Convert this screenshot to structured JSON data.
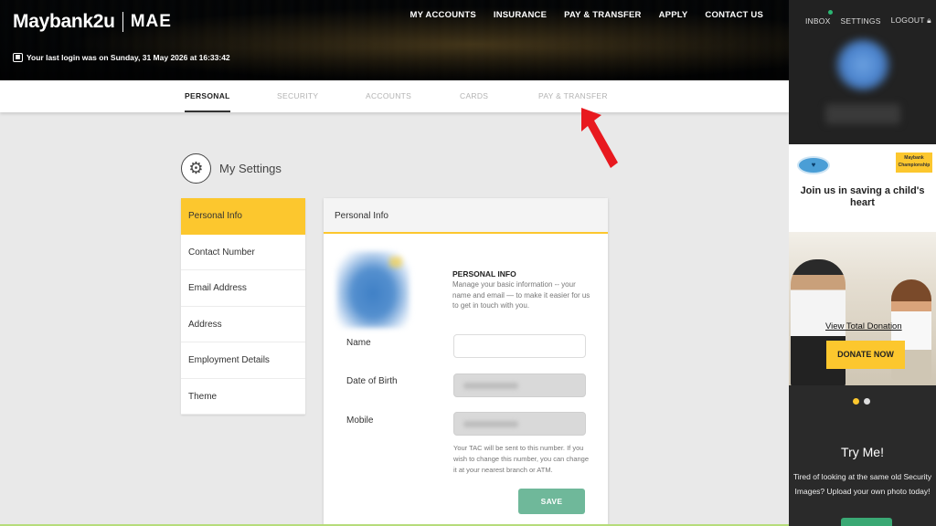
{
  "brand": {
    "name": "Maybank2u",
    "sub_brand": "MAE"
  },
  "last_login": "Your last login was on Sunday, 31 May 2026 at 16:33:42",
  "top_nav": [
    "MY ACCOUNTS",
    "INSURANCE",
    "PAY & TRANSFER",
    "APPLY",
    "CONTACT US"
  ],
  "right_nav": {
    "inbox": "INBOX",
    "settings": "SETTINGS",
    "logout": "LOGOUT"
  },
  "sub_nav": {
    "active": "PERSONAL",
    "items": [
      "PERSONAL",
      "SECURITY",
      "ACCOUNTS",
      "CARDS",
      "PAY & TRANSFER"
    ]
  },
  "settings": {
    "title": "My Settings"
  },
  "side_menu": {
    "items": [
      "Personal Info",
      "Contact Number",
      "Email Address",
      "Address",
      "Employment Details",
      "Theme"
    ]
  },
  "panel": {
    "header": "Personal Info",
    "section_title": "PERSONAL INFO",
    "section_desc": "Manage your basic information -- your name and email — to make it easier for us to get in touch with you.",
    "fields": [
      {
        "label": "Name",
        "value": ""
      },
      {
        "label": "Date of Birth"
      },
      {
        "label": "Mobile"
      }
    ],
    "tac_note": "Your TAC will be sent to this number. If you wish to change this number, you can change it at your nearest branch or ATM.",
    "save_label": "SAVE"
  },
  "ad": {
    "logo_right": "Maybank Championship",
    "title": "Join us in saving a child's heart",
    "link": "View Total Donation",
    "button": "DONATE NOW"
  },
  "try_me": {
    "title": "Try Me!",
    "text": "Tired of looking at the same old Security Images? Upload your own photo today!"
  },
  "colors": {
    "accent": "#fcc72e",
    "save_button": "#6fb89a",
    "arrow": "#e8191f",
    "sidebar_bg": "#2a2a2a"
  }
}
